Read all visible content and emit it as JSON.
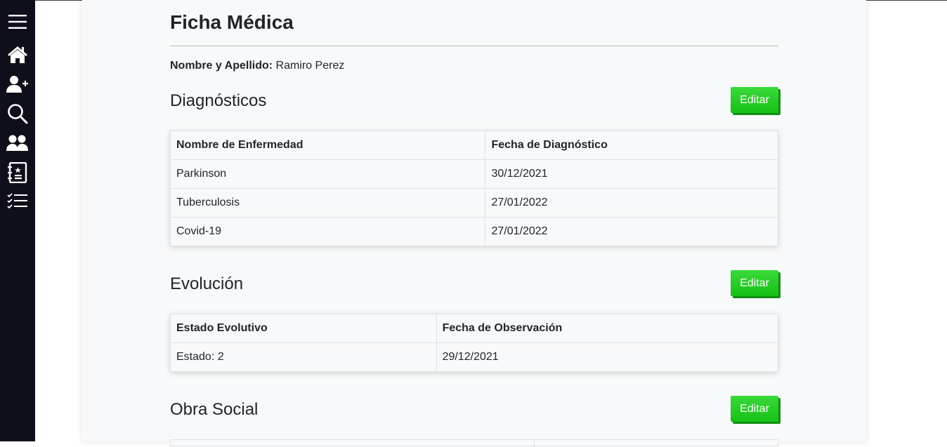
{
  "sidebar": {
    "items": [
      {
        "icon": "menu-icon"
      },
      {
        "icon": "home-icon"
      },
      {
        "icon": "add-user-icon"
      },
      {
        "icon": "search-icon"
      },
      {
        "icon": "users-icon"
      },
      {
        "icon": "contacts-icon"
      },
      {
        "icon": "checklist-icon"
      }
    ]
  },
  "page": {
    "title": "Ficha Médica",
    "patient_label": "Nombre y Apellido:",
    "patient_name": "Ramiro Perez"
  },
  "diagnosticos": {
    "title": "Diagnósticos",
    "edit_label": "Editar",
    "headers": [
      "Nombre de Enfermedad",
      "Fecha de Diagnóstico"
    ],
    "rows": [
      [
        "Parkinson",
        "30/12/2021"
      ],
      [
        "Tuberculosis",
        "27/01/2022"
      ],
      [
        "Covid-19",
        "27/01/2022"
      ]
    ]
  },
  "evolucion": {
    "title": "Evolución",
    "edit_label": "Editar",
    "headers": [
      "Estado Evolutivo",
      "Fecha de Observación"
    ],
    "rows": [
      [
        "Estado: 2",
        "29/12/2021"
      ]
    ]
  },
  "obra_social": {
    "title": "Obra Social",
    "edit_label": "Editar"
  },
  "colors": {
    "sidebar_bg": "#0f0f1b",
    "card_bg": "#f8f9fa",
    "button_green": "#22cc22"
  }
}
